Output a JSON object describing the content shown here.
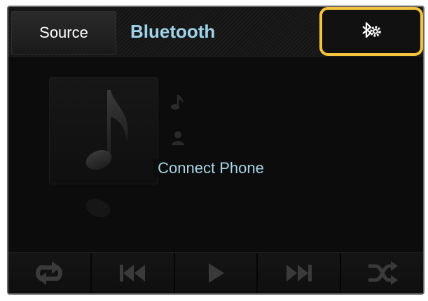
{
  "header": {
    "source_label": "Source",
    "title": "Bluetooth"
  },
  "status": {
    "message": "Connect Phone"
  },
  "icons": {
    "settings": "bluetooth-settings-icon",
    "repeat": "repeat-icon",
    "previous": "skip-previous-icon",
    "play": "play-icon",
    "next": "skip-next-icon",
    "shuffle": "shuffle-icon"
  },
  "colors": {
    "title": "#9fd3ea",
    "highlight": "#f3c33b",
    "background": "#0c0c0c"
  }
}
